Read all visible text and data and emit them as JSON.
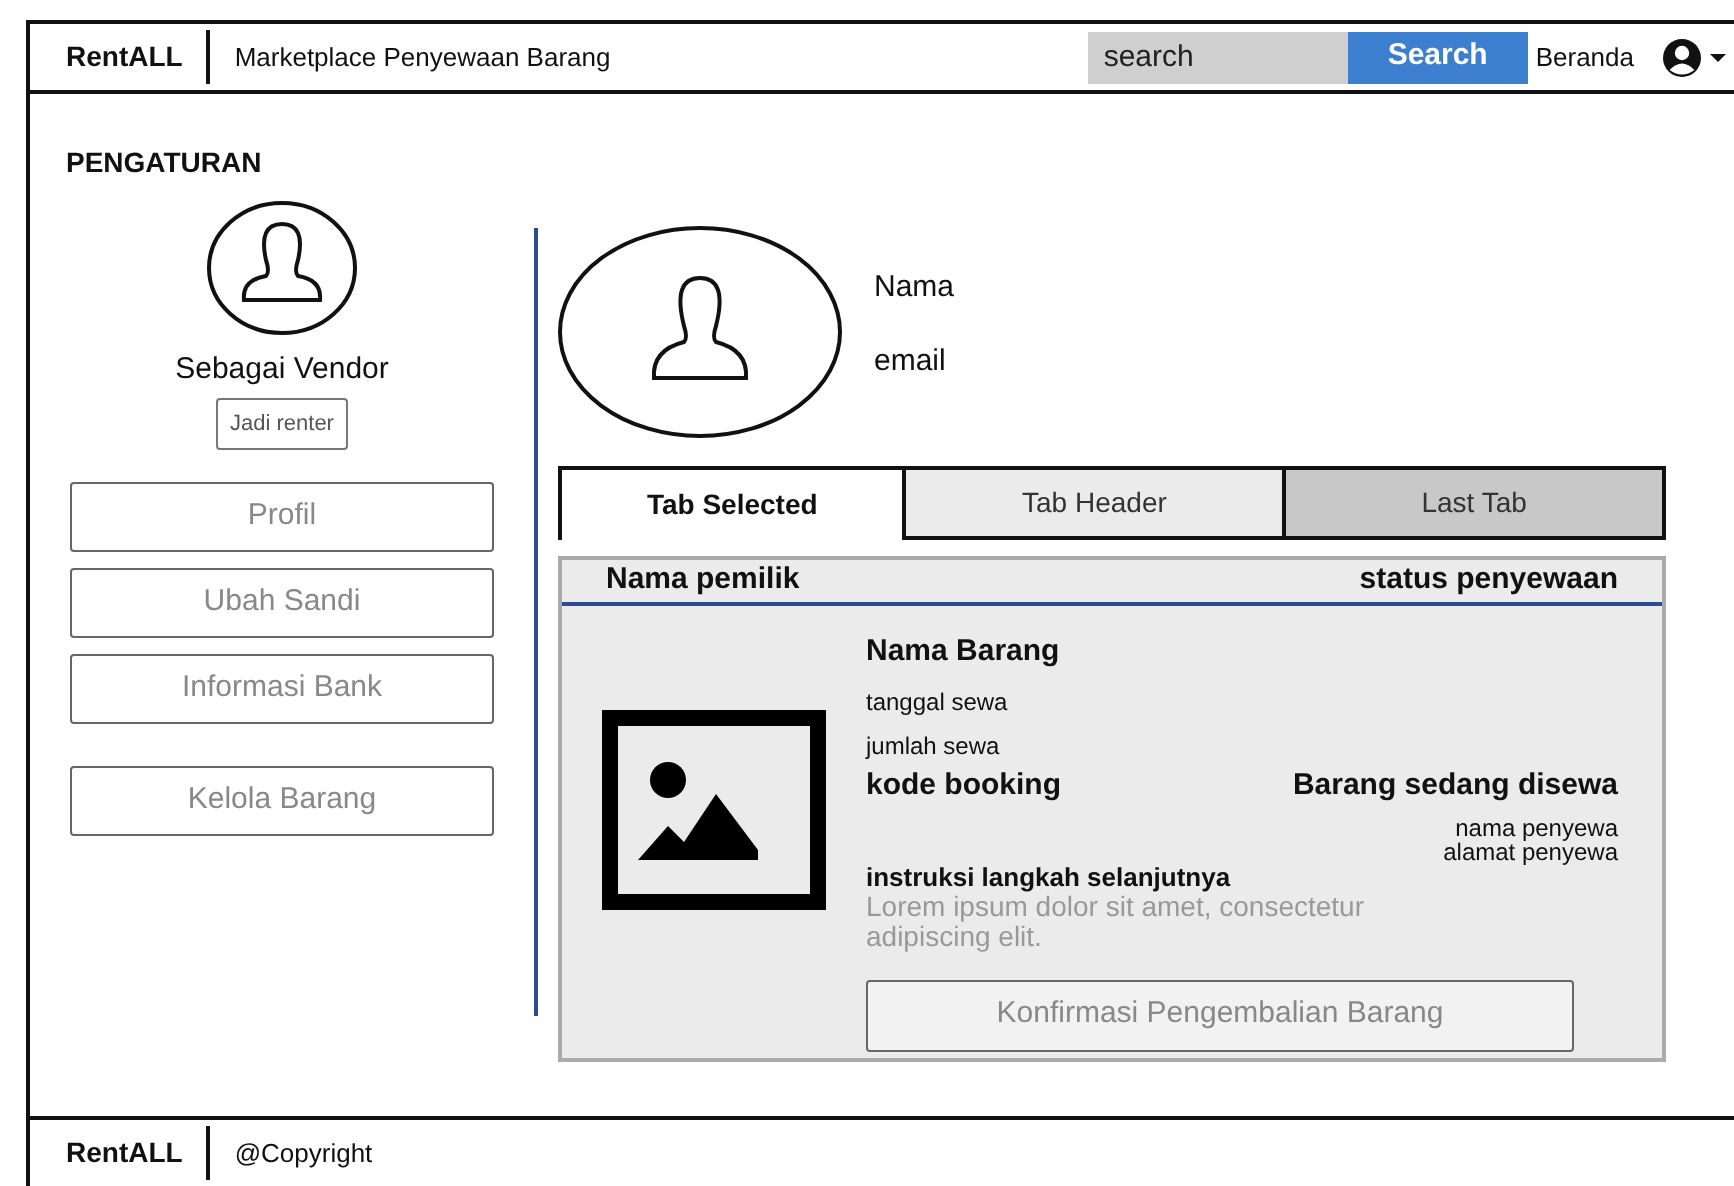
{
  "header": {
    "brand": "RentALL",
    "tagline": "Marketplace Penyewaan Barang",
    "search": {
      "placeholder": "search"
    },
    "search_button": "Search",
    "home_link": "Beranda"
  },
  "sidebar": {
    "title": "PENGATURAN",
    "role": "Sebagai Vendor",
    "switch_button": "Jadi renter",
    "menu": [
      {
        "label": "Profil"
      },
      {
        "label": "Ubah Sandi"
      },
      {
        "label": "Informasi Bank"
      },
      {
        "label": "Kelola Barang"
      }
    ]
  },
  "profile": {
    "name": "Nama",
    "email": "email"
  },
  "tabs": [
    {
      "label": "Tab Selected",
      "selected": true,
      "color": "#ffffff"
    },
    {
      "label": "Tab Header",
      "selected": false,
      "color": "#ebebeb"
    },
    {
      "label": "Last Tab",
      "selected": false,
      "color": "#c8c8c8"
    }
  ],
  "card": {
    "owner": "Nama pemilik",
    "status_heading": "status penyewaan",
    "item_name": "Nama Barang",
    "rent_date": "tanggal sewa",
    "rent_amount": "jumlah sewa",
    "booking_code": "kode booking",
    "status": "Barang sedang disewa",
    "renter_name": "nama penyewa",
    "renter_address": "alamat penyewa",
    "instruction_title": "instruksi langkah selanjutnya",
    "instruction_text": "Lorem ipsum dolor sit amet, consectetur adipiscing elit.",
    "confirm_button": "Konfirmasi Pengembalian Barang"
  },
  "footer": {
    "brand": "RentALL",
    "copyright": "@Copyright"
  }
}
